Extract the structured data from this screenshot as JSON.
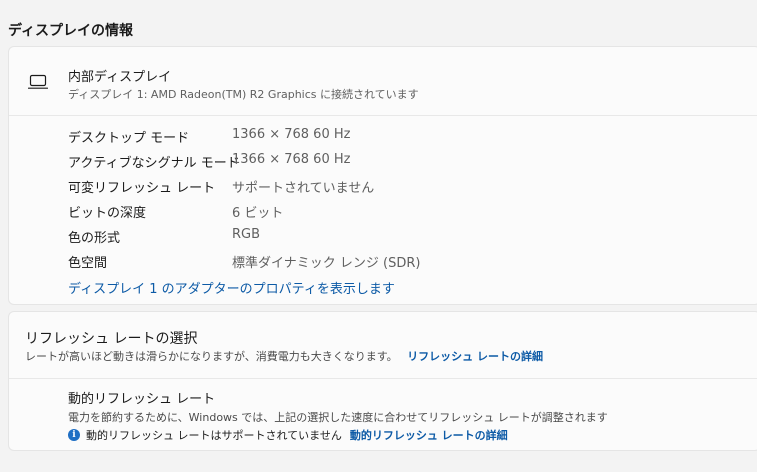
{
  "section": {
    "title": "ディスプレイの情報"
  },
  "display": {
    "icon": "laptop-icon",
    "name": "内部ディスプレイ",
    "subtitle": "ディスプレイ 1: AMD Radeon(TM) R2 Graphics に接続されています",
    "info": [
      {
        "label": "デスクトップ モード",
        "value": "1366 × 768 60 Hz"
      },
      {
        "label": "アクティブなシグナル モード",
        "value": "1366 × 768 60 Hz"
      },
      {
        "label": "可変リフレッシュ レート",
        "value": "サポートされていません"
      },
      {
        "label": "ビットの深度",
        "value": "6 ビット"
      },
      {
        "label": "色の形式",
        "value": "RGB"
      },
      {
        "label": "色空間",
        "value": "標準ダイナミック レンジ (SDR)"
      }
    ],
    "adapter_link": "ディスプレイ 1 のアダプターのプロパティを表示します"
  },
  "refresh": {
    "title": "リフレッシュ レートの選択",
    "description": "レートが高いほど動きは滑らかになりますが、消費電力も大きくなります。",
    "details_link": "リフレッシュ レートの詳細",
    "dynamic": {
      "title": "動的リフレッシュ レート",
      "description": "電力を節約するために、Windows では、上記の選択した速度に合わせてリフレッシュ レートが調整されます",
      "note_icon": "info-icon",
      "note": "動的リフレッシュ レートはサポートされていません",
      "details_link": "動的リフレッシュ レートの詳細"
    }
  },
  "colors": {
    "background": "#f3f3f3",
    "card": "#fbfbfb",
    "link": "#0c5aa6",
    "info_icon": "#1f6fc4"
  }
}
